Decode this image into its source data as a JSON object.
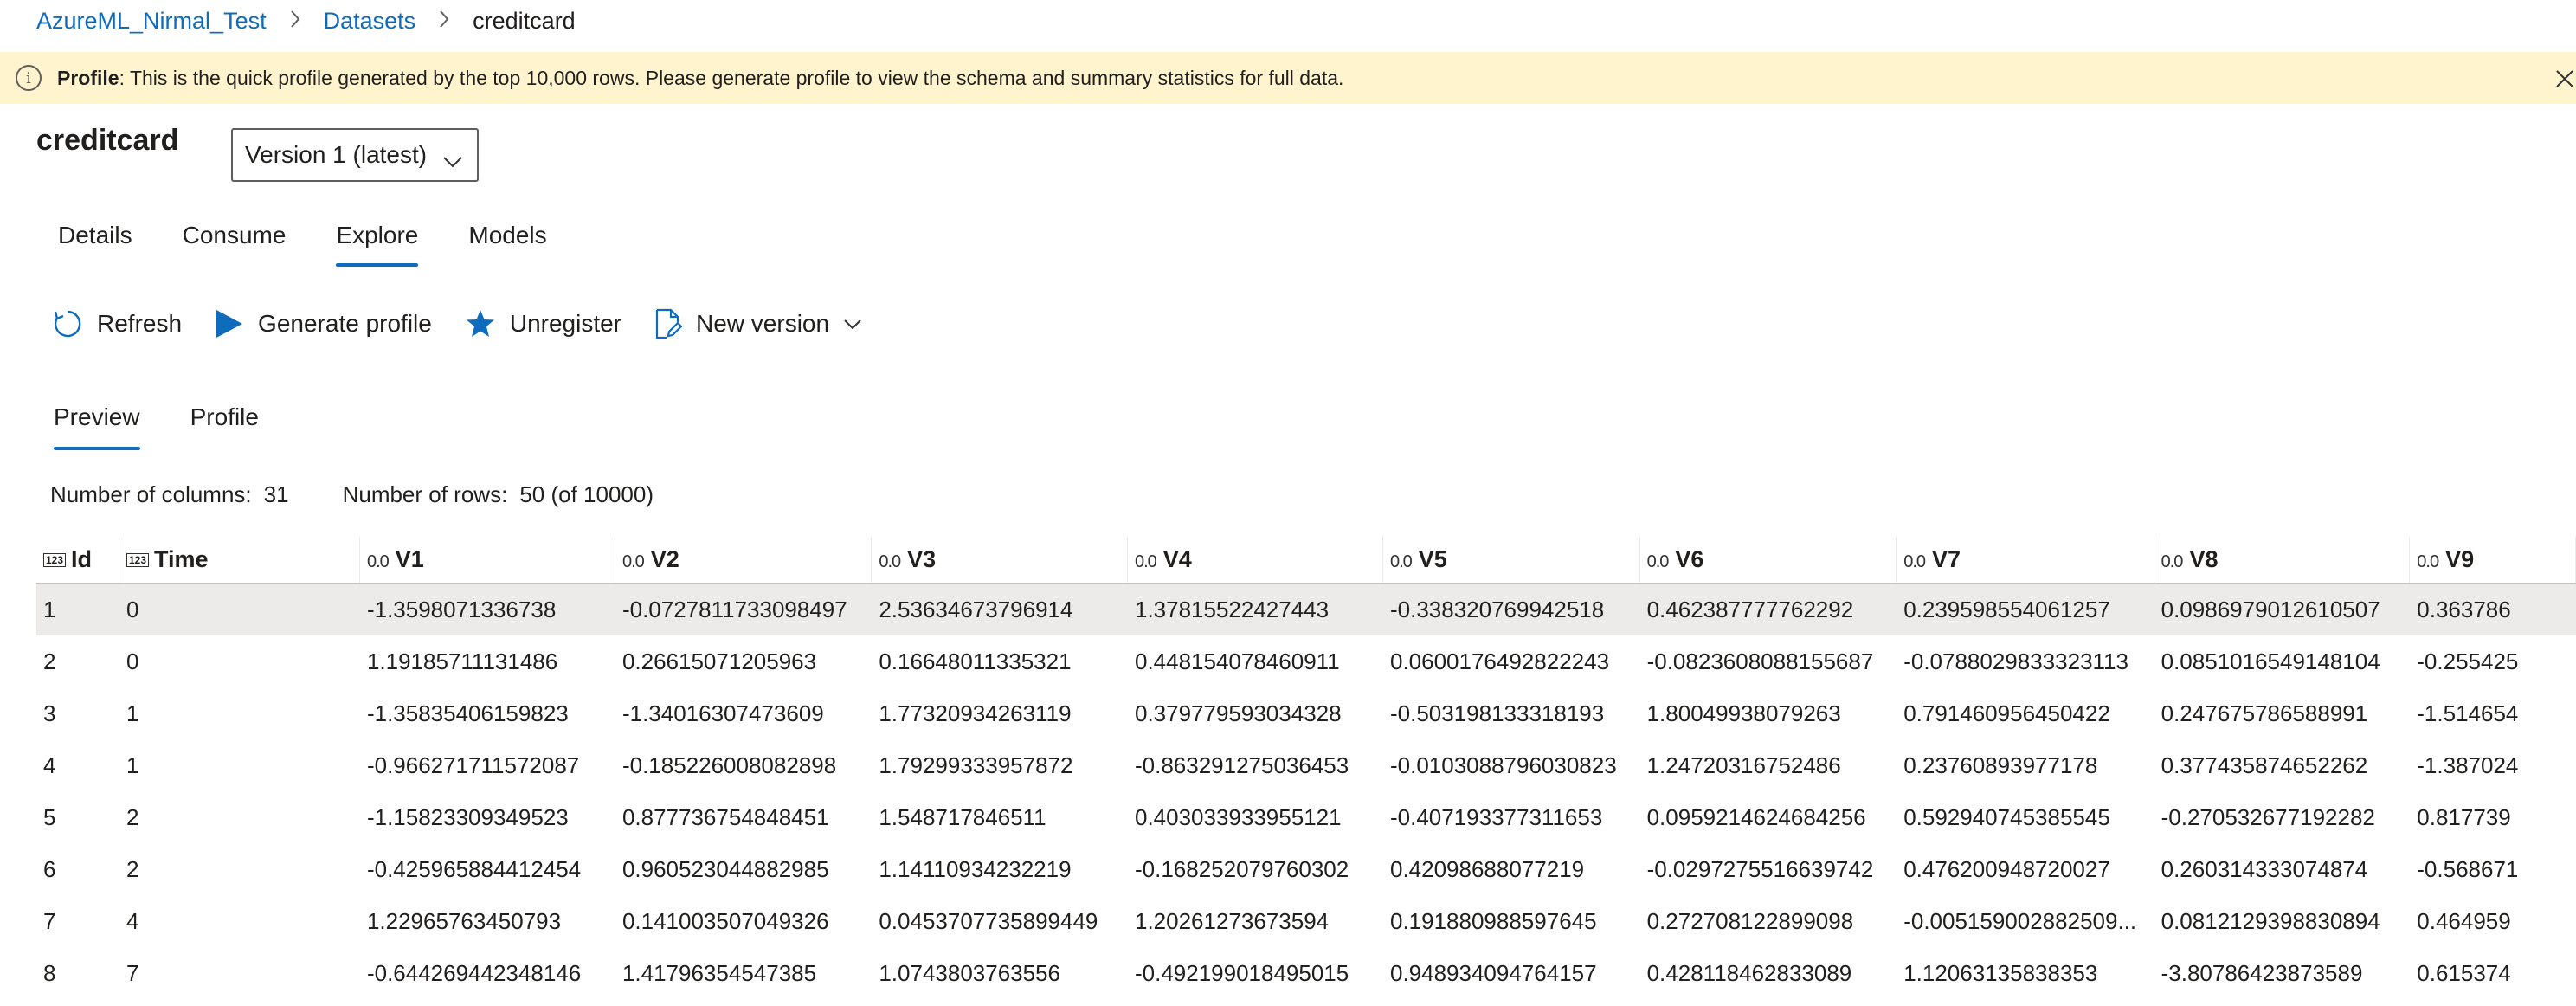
{
  "breadcrumb": {
    "workspace": "AzureML_Nirmal_Test",
    "section": "Datasets",
    "current": "creditcard"
  },
  "banner": {
    "label": "Profile",
    "message": ": This is the quick profile generated by the top 10,000 rows. Please generate profile to view the schema and summary statistics for full data."
  },
  "dataset": {
    "title": "creditcard",
    "version_selected": "Version 1 (latest)"
  },
  "tabs": [
    {
      "label": "Details"
    },
    {
      "label": "Consume"
    },
    {
      "label": "Explore"
    },
    {
      "label": "Models"
    }
  ],
  "toolbar": {
    "refresh": "Refresh",
    "generate_profile": "Generate profile",
    "unregister": "Unregister",
    "new_version": "New version"
  },
  "subtabs": [
    {
      "label": "Preview"
    },
    {
      "label": "Profile"
    }
  ],
  "counts": {
    "columns_label": "Number of columns:",
    "columns_value": "31",
    "rows_label": "Number of rows:",
    "rows_value": "50 (of 10000)"
  },
  "table": {
    "columns": [
      {
        "name": "Id",
        "type": "123"
      },
      {
        "name": "Time",
        "type": "123"
      },
      {
        "name": "V1",
        "type": "0.0"
      },
      {
        "name": "V2",
        "type": "0.0"
      },
      {
        "name": "V3",
        "type": "0.0"
      },
      {
        "name": "V4",
        "type": "0.0"
      },
      {
        "name": "V5",
        "type": "0.0"
      },
      {
        "name": "V6",
        "type": "0.0"
      },
      {
        "name": "V7",
        "type": "0.0"
      },
      {
        "name": "V8",
        "type": "0.0"
      },
      {
        "name": "V9",
        "type": "0.0"
      }
    ],
    "rows": [
      [
        "1",
        "0",
        "-1.3598071336738",
        "-0.0727811733098497",
        "2.53634673796914",
        "1.37815522427443",
        "-0.338320769942518",
        "0.462387777762292",
        "0.239598554061257",
        "0.0986979012610507",
        "0.363786"
      ],
      [
        "2",
        "0",
        "1.19185711131486",
        "0.26615071205963",
        "0.16648011335321",
        "0.448154078460911",
        "0.0600176492822243",
        "-0.0823608088155687",
        "-0.0788029833323113",
        "0.0851016549148104",
        "-0.255425"
      ],
      [
        "3",
        "1",
        "-1.35835406159823",
        "-1.34016307473609",
        "1.77320934263119",
        "0.379779593034328",
        "-0.503198133318193",
        "1.80049938079263",
        "0.791460956450422",
        "0.247675786588991",
        "-1.514654"
      ],
      [
        "4",
        "1",
        "-0.966271711572087",
        "-0.185226008082898",
        "1.79299333957872",
        "-0.863291275036453",
        "-0.0103088796030823",
        "1.24720316752486",
        "0.23760893977178",
        "0.377435874652262",
        "-1.387024"
      ],
      [
        "5",
        "2",
        "-1.15823309349523",
        "0.877736754848451",
        "1.548717846511",
        "0.403033933955121",
        "-0.407193377311653",
        "0.0959214624684256",
        "0.592940745385545",
        "-0.270532677192282",
        "0.817739"
      ],
      [
        "6",
        "2",
        "-0.425965884412454",
        "0.960523044882985",
        "1.14110934232219",
        "-0.168252079760302",
        "0.42098688077219",
        "-0.0297275516639742",
        "0.476200948720027",
        "0.260314333074874",
        "-0.568671"
      ],
      [
        "7",
        "4",
        "1.22965763450793",
        "0.141003507049326",
        "0.0453707735899449",
        "1.20261273673594",
        "0.191880988597645",
        "0.272708122899098",
        "-0.005159002882509...",
        "0.0812129398830894",
        "0.464959"
      ],
      [
        "8",
        "7",
        "-0.644269442348146",
        "1.41796354547385",
        "1.0743803763556",
        "-0.492199018495015",
        "0.948934094764157",
        "0.428118462833089",
        "1.12063135838353",
        "-3.80786423873589",
        "0.615374"
      ]
    ]
  }
}
